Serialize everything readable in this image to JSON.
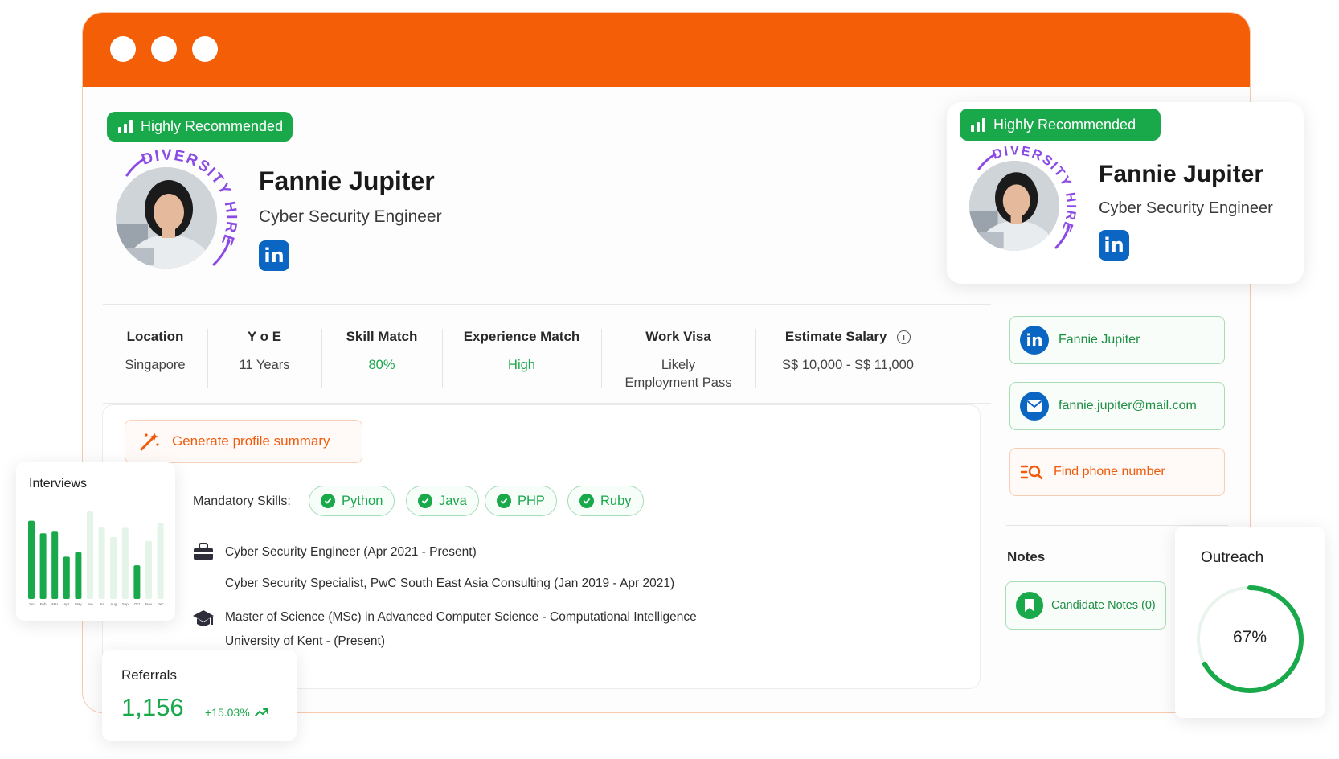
{
  "colors": {
    "brand_orange": "#f45e07",
    "green": "#19a84a",
    "linkedin_blue": "#0a66c2",
    "purple": "#8b4ae6"
  },
  "badge": {
    "label": "Highly Recommended"
  },
  "diversity_text": "DIVERSITY HIRE",
  "candidate": {
    "name": "Fannie Jupiter",
    "role": "Cyber Security Engineer",
    "linkedin_icon": "in"
  },
  "stats": [
    {
      "label": "Location",
      "value": "Singapore"
    },
    {
      "label": "Y o E",
      "value": "11 Years"
    },
    {
      "label": "Skill Match",
      "value": "80%"
    },
    {
      "label": "Experience Match",
      "value": "High"
    },
    {
      "label": "Work Visa",
      "value_line1": "Likely",
      "value_line2": "Employment Pass"
    },
    {
      "label": "Estimate Salary",
      "value": "S$ 10,000 - S$ 11,000",
      "info_icon": "i"
    }
  ],
  "generate_summary": {
    "label": "Generate profile summary"
  },
  "skills": {
    "label": "Mandatory Skills:",
    "items": [
      "Python",
      "Java",
      "PHP",
      "Ruby"
    ]
  },
  "experience": [
    "Cyber Security Engineer (Apr 2021 - Present)",
    "Cyber Security Specialist, PwC South East Asia Consulting (Jan 2019 - Apr 2021)"
  ],
  "education": [
    "Master of Science (MSc) in Advanced Computer Science - Computational Intelligence",
    "University of Kent - (Present)"
  ],
  "contacts": {
    "linkedin": "Fannie Jupiter",
    "email": "fannie.jupiter@mail.com",
    "phone": "Find phone number"
  },
  "notes": {
    "heading": "Notes",
    "button": "Candidate Notes (0)"
  },
  "interviews_card": {
    "title": "Interviews",
    "months": [
      "Jan",
      "Feb",
      "Mar",
      "Apr",
      "May",
      "Jun",
      "Jul",
      "Aug",
      "Sep",
      "Oct",
      "Nov",
      "Dec"
    ]
  },
  "chart_data": {
    "type": "bar",
    "title": "Interviews",
    "categories": [
      "Jan",
      "Feb",
      "Mar",
      "Apr",
      "May",
      "Jun",
      "Jul",
      "Aug",
      "Sep",
      "Oct",
      "Nov",
      "Dec"
    ],
    "series": [
      {
        "values": [
          100,
          84,
          86,
          54,
          60,
          0,
          0,
          0,
          0,
          43,
          0,
          0
        ],
        "color": "#19a84a"
      },
      {
        "values": [
          0,
          0,
          0,
          0,
          0,
          112,
          92,
          79,
          91,
          0,
          74,
          97
        ],
        "color": "#e4f4e8"
      }
    ],
    "ylim": [
      0,
      115
    ]
  },
  "referrals_card": {
    "title": "Referrals",
    "value": "1,156",
    "change": "+15.03%"
  },
  "outreach_card": {
    "title": "Outreach",
    "value": "67%",
    "percent": 67
  }
}
